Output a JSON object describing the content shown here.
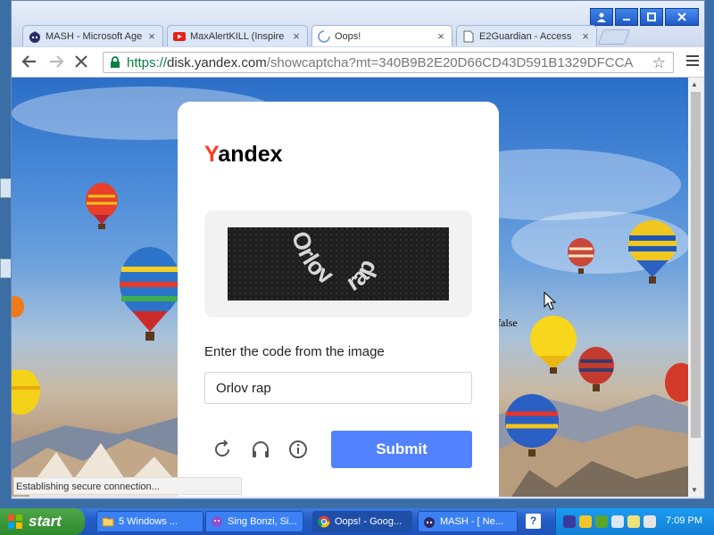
{
  "window": {
    "tabs": [
      {
        "label": "MASH - Microsoft Age",
        "icon": "mash-icon",
        "active": false
      },
      {
        "label": "MaxAlertKILL (Inspire",
        "icon": "youtube-icon",
        "active": false
      },
      {
        "label": "Oops!",
        "icon": "loading-spinner-icon",
        "active": true
      },
      {
        "label": "E2Guardian - Access",
        "icon": "page-icon",
        "active": false
      }
    ],
    "tab_close": "×",
    "controls": {
      "user": "user-icon",
      "minimize": "minimize-icon",
      "maximize": "maximize-icon",
      "close": "close-icon"
    }
  },
  "toolbar": {
    "url_scheme": "https://",
    "url_host": "disk.yandex.com",
    "url_path": "/showcaptcha?mt=340B9B2E20D66CD43D591B1329DFCCA"
  },
  "captcha": {
    "logo_first": "Y",
    "logo_rest": "andex",
    "image_text_1": "Orlov",
    "image_text_2": "rap",
    "prompt": "Enter the code from the image",
    "input_value": "Orlov rap",
    "submit_label": "Submit"
  },
  "page": {
    "stray_text": "false",
    "status": "Establishing secure connection..."
  },
  "taskbar": {
    "start_label": "start",
    "tasks": [
      {
        "label": "5 Windows ..."
      },
      {
        "label": "Sing Bonzi, Si..."
      },
      {
        "label": "Oops! - Goog..."
      },
      {
        "label": "MASH - [ Ne..."
      }
    ],
    "help": "?",
    "clock": "7:09 PM"
  },
  "colors": {
    "yandex_red": "#fc3f1d",
    "submit_blue": "#5282ff",
    "url_green": "#0b8043"
  }
}
